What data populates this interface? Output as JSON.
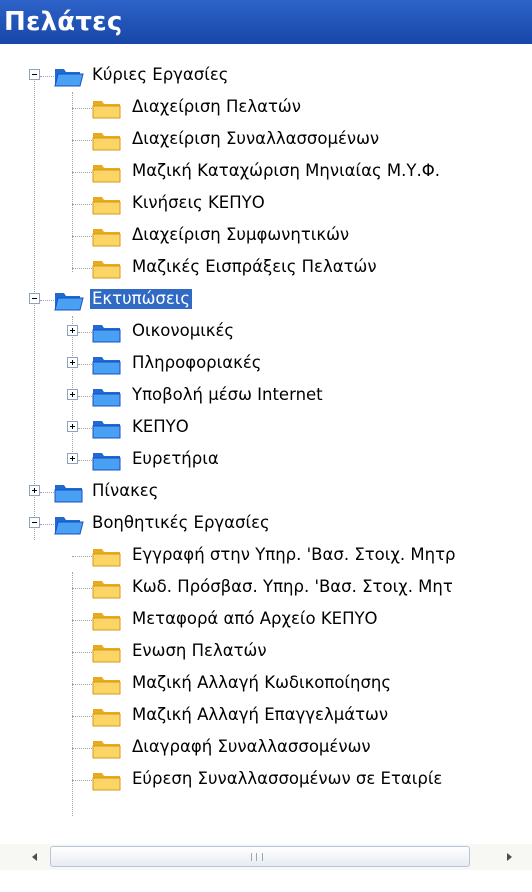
{
  "window": {
    "title": "Πελάτες"
  },
  "tree": {
    "main_tasks": {
      "label": "Κύριες Εργασίες",
      "items": [
        "Διαχείριση Πελατών",
        "Διαχείριση Συναλλασσομένων",
        "Μαζική Καταχώριση Μηνιαίας Μ.Υ.Φ.",
        "Κινήσεις ΚΕΠΥΟ",
        "Διαχείριση Συμφωνητικών",
        "Μαζικές Εισπράξεις Πελατών"
      ]
    },
    "prints": {
      "label": "Εκτυπώσεις",
      "selected": true,
      "items": [
        "Οικονομικές",
        "Πληροφοριακές",
        "Υποβολή μέσω Internet",
        "ΚΕΠΥΟ",
        "Ευρετήρια"
      ]
    },
    "tables": {
      "label": "Πίνακες"
    },
    "aux_tasks": {
      "label": "Βοηθητικές Εργασίες",
      "items": [
        "Εγγραφή στην Υπηρ. 'Βασ. Στοιχ. Μητρ",
        "Κωδ. Πρόσβασ. Υπηρ. 'Βασ. Στοιχ. Μητ",
        "Μεταφορά από Αρχείο ΚΕΠΥΟ",
        "Ενωση Πελατών",
        "Μαζική Αλλαγή Κωδικοποίησης",
        "Μαζική Αλλαγή Επαγγελμάτων",
        "Διαγραφή Συναλλασσομένων",
        "Εύρεση Συναλλασσομένων σε Εταιρίε"
      ]
    }
  },
  "icons": {
    "open_folder": "open-folder-icon",
    "closed_folder": "folder-icon",
    "blue_color": "#2c7be0",
    "yellow_color": "#f9cf58"
  },
  "colors": {
    "title_bg": "#1846a8",
    "selection": "#316ac5"
  }
}
